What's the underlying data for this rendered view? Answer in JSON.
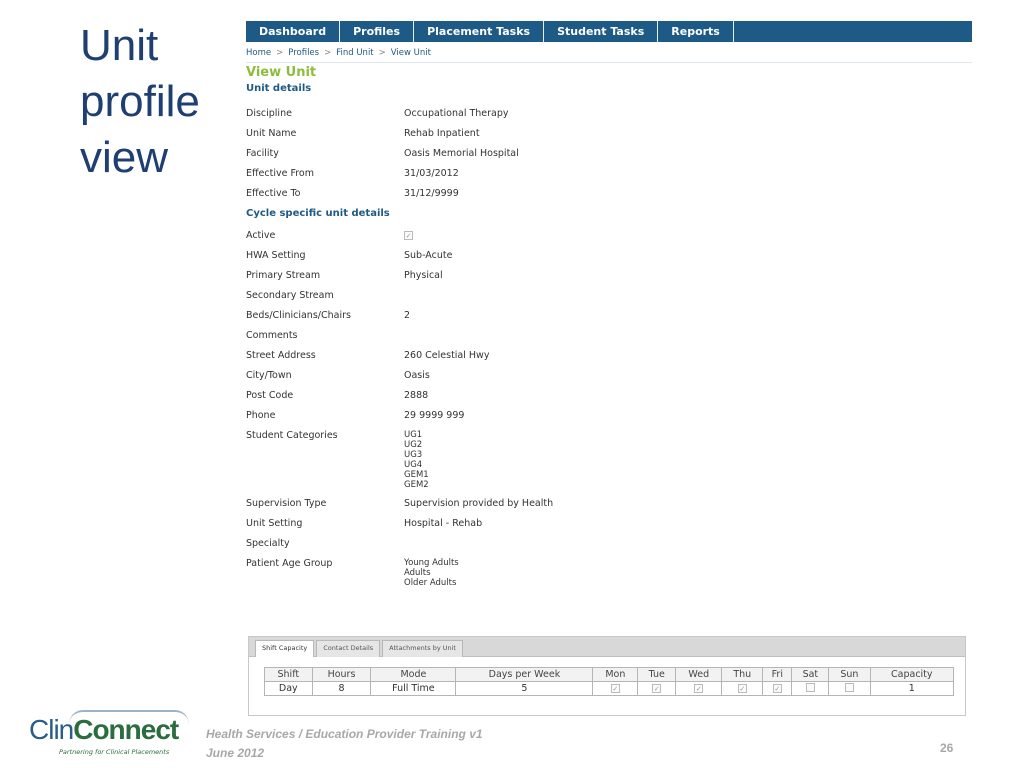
{
  "slide": {
    "title": "Unit profile view",
    "footer_line1": "Health Services / Education Provider Training v1",
    "footer_line2": "June 2012",
    "page_number": "26"
  },
  "logo": {
    "part1": "Clin",
    "part2": "Connect",
    "tagline": "Partnering for Clinical Placements"
  },
  "nav": {
    "items": [
      "Dashboard",
      "Profiles",
      "Placement Tasks",
      "Student Tasks",
      "Reports"
    ]
  },
  "breadcrumb": [
    "Home",
    "Profiles",
    "Find Unit",
    "View Unit"
  ],
  "page": {
    "title": "View Unit",
    "section1": "Unit details",
    "section2": "Cycle specific unit details"
  },
  "unit_details": [
    {
      "label": "Discipline",
      "value": "Occupational Therapy"
    },
    {
      "label": "Unit Name",
      "value": "Rehab Inpatient"
    },
    {
      "label": "Facility",
      "value": "Oasis Memorial Hospital"
    },
    {
      "label": "Effective From",
      "value": "31/03/2012"
    },
    {
      "label": "Effective To",
      "value": "31/12/9999"
    }
  ],
  "cycle_details": [
    {
      "label": "Active",
      "value": "",
      "checkbox": true
    },
    {
      "label": "HWA Setting",
      "value": "Sub-Acute"
    },
    {
      "label": "Primary Stream",
      "value": "Physical"
    },
    {
      "label": "Secondary Stream",
      "value": ""
    },
    {
      "label": "Beds/Clinicians/Chairs",
      "value": "2"
    },
    {
      "label": "Comments",
      "value": ""
    },
    {
      "label": "Street Address",
      "value": "260 Celestial Hwy"
    },
    {
      "label": "City/Town",
      "value": "Oasis"
    },
    {
      "label": "Post Code",
      "value": "2888"
    },
    {
      "label": "Phone",
      "value": "29 9999 999"
    },
    {
      "label": "Student Categories",
      "value": "UG1\nUG2\nUG3\nUG4\nGEM1\nGEM2"
    },
    {
      "label": "Supervision Type",
      "value": "Supervision provided by Health"
    },
    {
      "label": "Unit Setting",
      "value": "Hospital - Rehab"
    },
    {
      "label": "Specialty",
      "value": ""
    },
    {
      "label": "Patient Age Group",
      "value": "Young Adults\nAdults\nOlder Adults"
    }
  ],
  "tabs": [
    "Shift Capacity",
    "Contact Details",
    "Attachments by Unit"
  ],
  "shift_table": {
    "headers": [
      "Shift",
      "Hours",
      "Mode",
      "Days per Week",
      "Mon",
      "Tue",
      "Wed",
      "Thu",
      "Fri",
      "Sat",
      "Sun",
      "Capacity"
    ],
    "row": {
      "shift": "Day",
      "hours": "8",
      "mode": "Full Time",
      "days_per_week": "5",
      "capacity": "1"
    },
    "days_checked": [
      true,
      true,
      true,
      true,
      true,
      false,
      false
    ]
  }
}
